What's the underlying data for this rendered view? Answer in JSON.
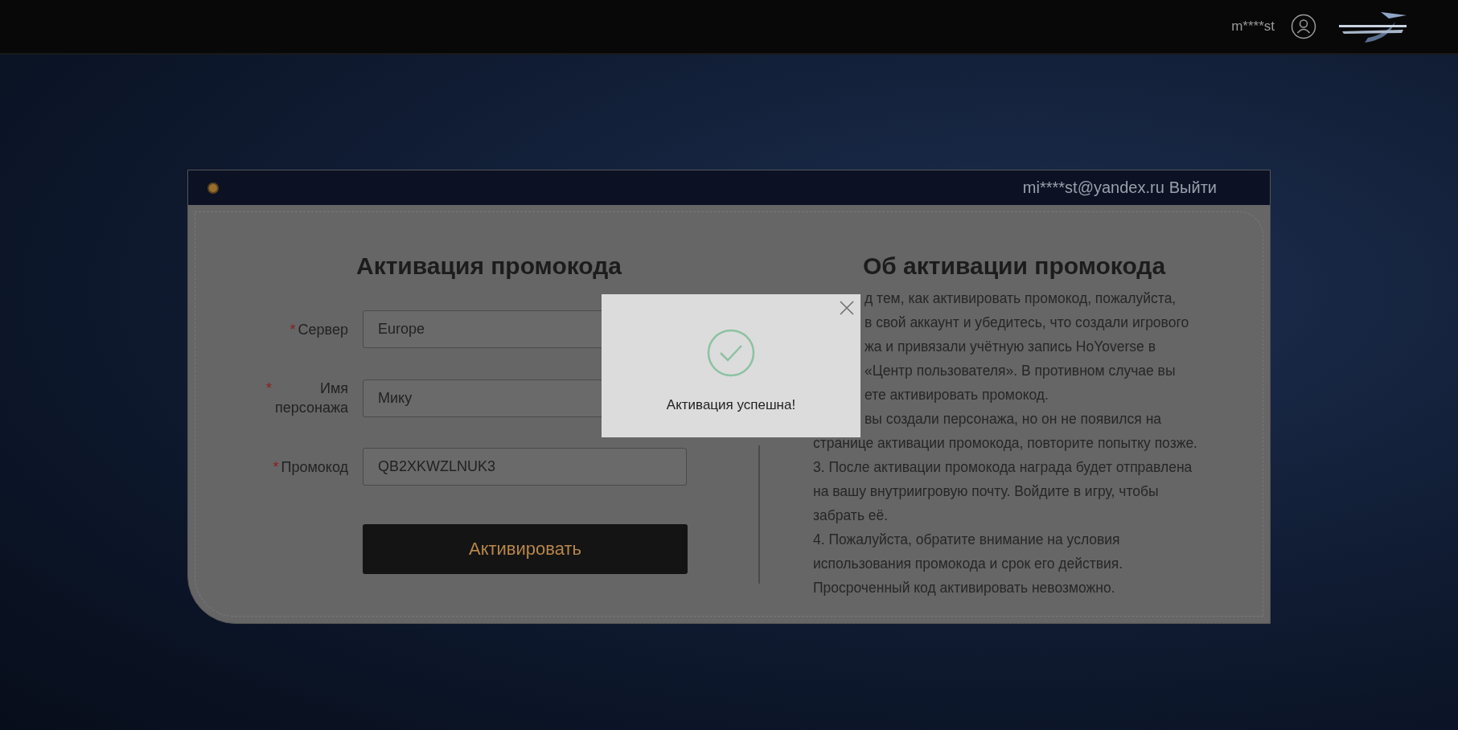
{
  "top_bar": {
    "username": "m****st"
  },
  "card": {
    "account": "mi****st@yandex.ru",
    "logout": "Выйти"
  },
  "form": {
    "title": "Активация промокода",
    "fields": [
      {
        "marker": "*",
        "label": "Сервер",
        "value": "Europe"
      },
      {
        "marker": "*",
        "label": "Имя персонажа",
        "value": "Мику"
      },
      {
        "marker": "*",
        "label": "Промокод",
        "value": "QB2XKWZLNUK3"
      }
    ],
    "button": "Активировать"
  },
  "info": {
    "title": "Об активации промокода",
    "partly_hidden_lines": [
      "д тем, как активировать промокод, пожалуйста,",
      "в свой аккаунт и убедитесь, что создали игрового",
      "жа и привязали учётную запись HoYoverse в",
      "«Центр пользователя». В противном случае вы",
      "ете активировать промокод.",
      "вы создали персонажа, но он не появился на"
    ],
    "lines": [
      "странице активации промокода, повторите попытку позже.",
      "3. После активации промокода награда будет отправлена",
      "на вашу внутриигровую почту. Войдите в игру, чтобы",
      "забрать её.",
      "4. Пожалуйста, обратите внимание на условия",
      "использования промокода и срок его действия.",
      "Просроченный код активировать невозможно."
    ]
  },
  "dialog": {
    "message": "Активация успешна!"
  }
}
